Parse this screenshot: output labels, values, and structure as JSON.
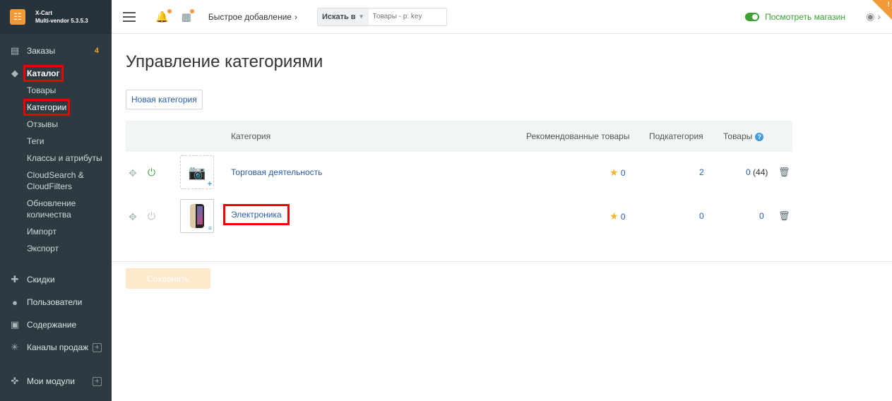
{
  "brand": {
    "name": "X-Cart",
    "version": "Multi-vendor 5.3.5.3"
  },
  "sidebar": {
    "orders": {
      "label": "Заказы",
      "count": "4"
    },
    "catalog": {
      "label": "Каталог",
      "items": [
        "Товары",
        "Категории",
        "Отзывы",
        "Теги",
        "Классы и атрибуты",
        "CloudSearch & CloudFilters",
        "Обновление количества",
        "Импорт",
        "Экспорт"
      ]
    },
    "discounts": "Скидки",
    "users": "Пользователи",
    "content": "Содержание",
    "sales_channels": "Каналы продаж",
    "my_modules": "Мои модули"
  },
  "topbar": {
    "quick_add": "Быстрое добавление",
    "search_in": "Искать в",
    "search_placeholder": "Товары - p: key",
    "view_store": "Посмотреть магазин",
    "corner_mark": "!"
  },
  "main": {
    "title": "Управление категориями",
    "new_category_button": "Новая категория",
    "table": {
      "headers": {
        "category": "Категория",
        "featured": "Рекомендованные товары",
        "subcategories": "Подкатегория",
        "products": "Товары",
        "help": "?"
      },
      "rows": [
        {
          "name": "Торговая деятельность",
          "featured": "0",
          "subcategories": "2",
          "products": "0",
          "products_total": "(44)",
          "enabled": true
        },
        {
          "name": "Электроника",
          "featured": "0",
          "subcategories": "0",
          "products": "0",
          "products_total": "",
          "enabled": false
        }
      ]
    },
    "save_button": "Сохранить"
  },
  "colors": {
    "sidebar": "#2d3a41",
    "accent": "#f29a37",
    "link": "#2a5db0",
    "enabled": "#3aa235",
    "highlight": "#e00000"
  },
  "icons": [
    "orders-icon",
    "catalog-icon",
    "gift-icon",
    "users-icon",
    "content-icon",
    "channels-icon",
    "modules-icon",
    "bell-icon",
    "stats-icon",
    "user-icon",
    "move-icon",
    "power-icon",
    "camera-icon",
    "star-icon",
    "trash-icon"
  ]
}
